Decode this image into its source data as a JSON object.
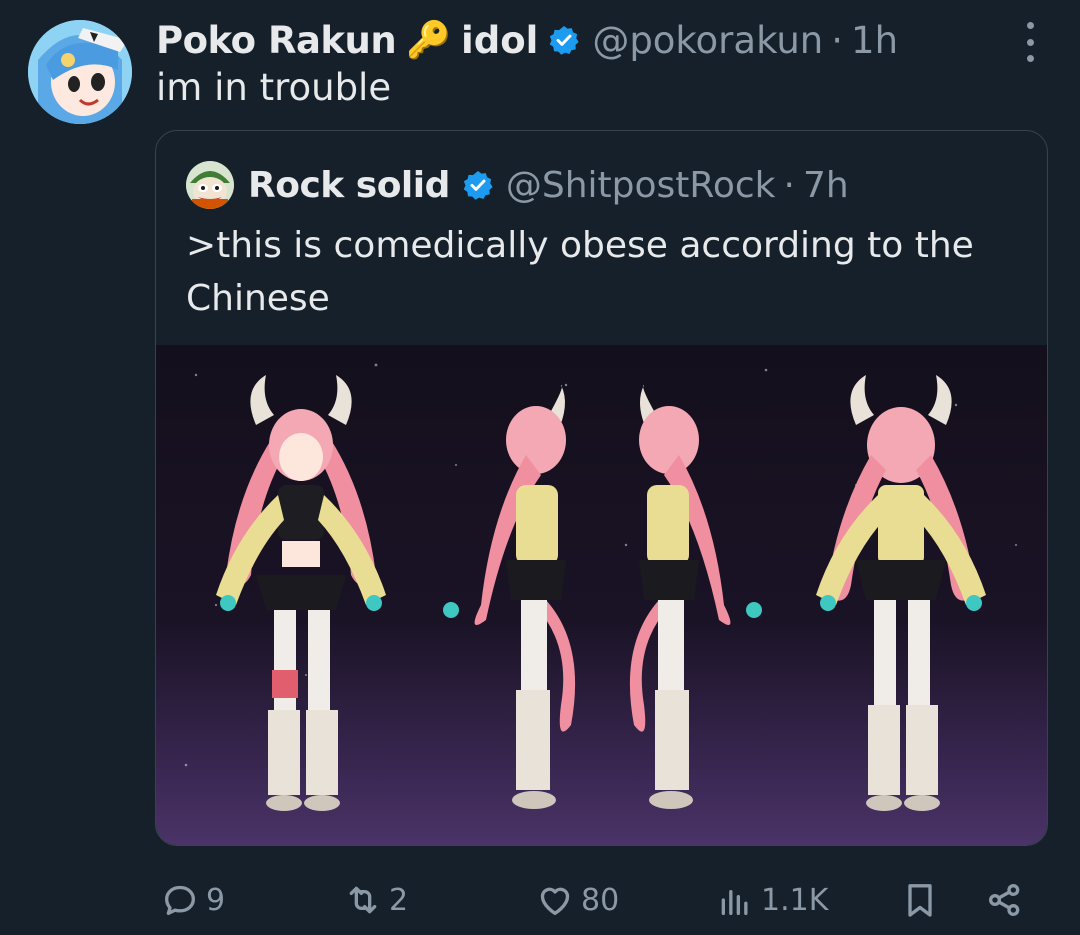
{
  "post": {
    "display_name": "Poko Rakun",
    "emoji": "🔑",
    "role_label": "idol",
    "handle": "@pokorakun",
    "separator": "·",
    "time": "1h",
    "text": "im in trouble"
  },
  "quote": {
    "display_name": "Rock solid",
    "handle": "@ShitpostRock",
    "separator": "·",
    "time": "7h",
    "text": ">this is comedically obese according to the Chinese",
    "media_alt": "Character reference sheet showing four views of a pink-haired horned character"
  },
  "actions": {
    "replies": "9",
    "reposts": "2",
    "likes": "80",
    "views": "1.1K"
  },
  "colors": {
    "background": "#15202b",
    "text": "#e7e9ea",
    "secondary": "#8b98a5",
    "verified": "#1d9bf0",
    "border": "#38444d"
  },
  "icons": [
    "more-icon",
    "verified-icon",
    "reply-icon",
    "repost-icon",
    "like-icon",
    "views-icon",
    "bookmark-icon",
    "share-icon"
  ]
}
